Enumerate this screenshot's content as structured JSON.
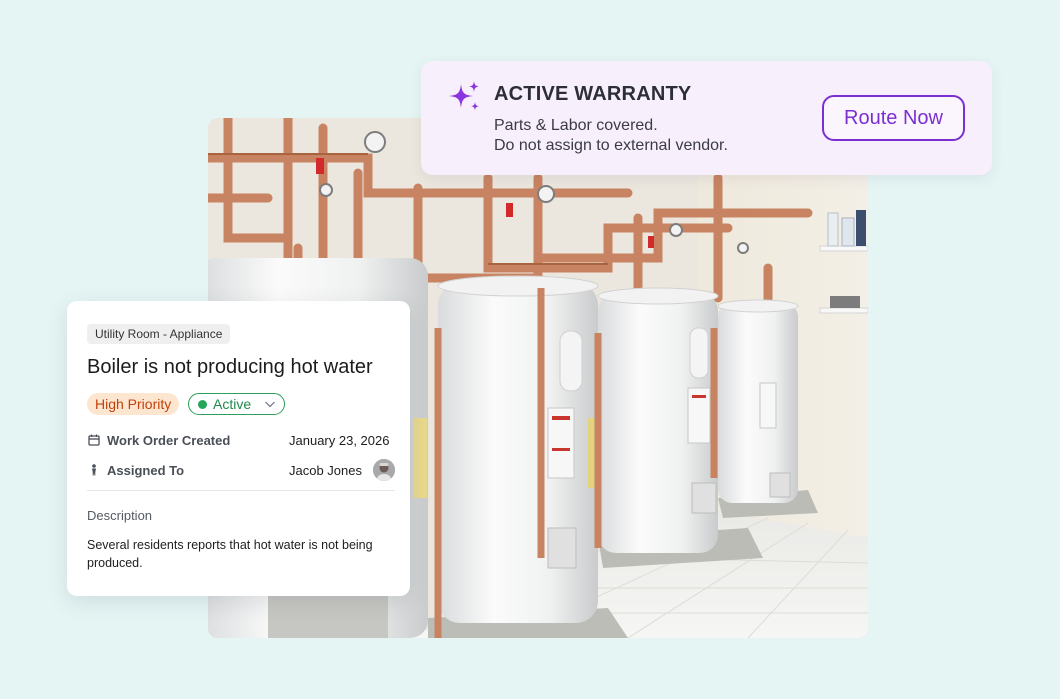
{
  "warranty": {
    "title": "ACTIVE WARRANTY",
    "line1": "Parts & Labor covered.",
    "line2": "Do not assign to external vendor.",
    "button_label": "Route Now",
    "icon": "sparkle-icon",
    "accent_color": "#7b2fd0"
  },
  "work_order": {
    "location_tag": "Utility Room - Appliance",
    "title": "Boiler is not producing hot water",
    "priority": "High Priority",
    "status": "Active",
    "created_label": "Work Order Created",
    "created_value": "January 23, 2026",
    "assigned_label": "Assigned To",
    "assigned_value": "Jacob Jones",
    "description_label": "Description",
    "description_text": "Several residents reports that hot water is not being produced."
  },
  "colors": {
    "background": "#e5f5f4",
    "priority_bg": "#fde6cf",
    "priority_text": "#c2410c",
    "status_green": "#23a55a"
  }
}
